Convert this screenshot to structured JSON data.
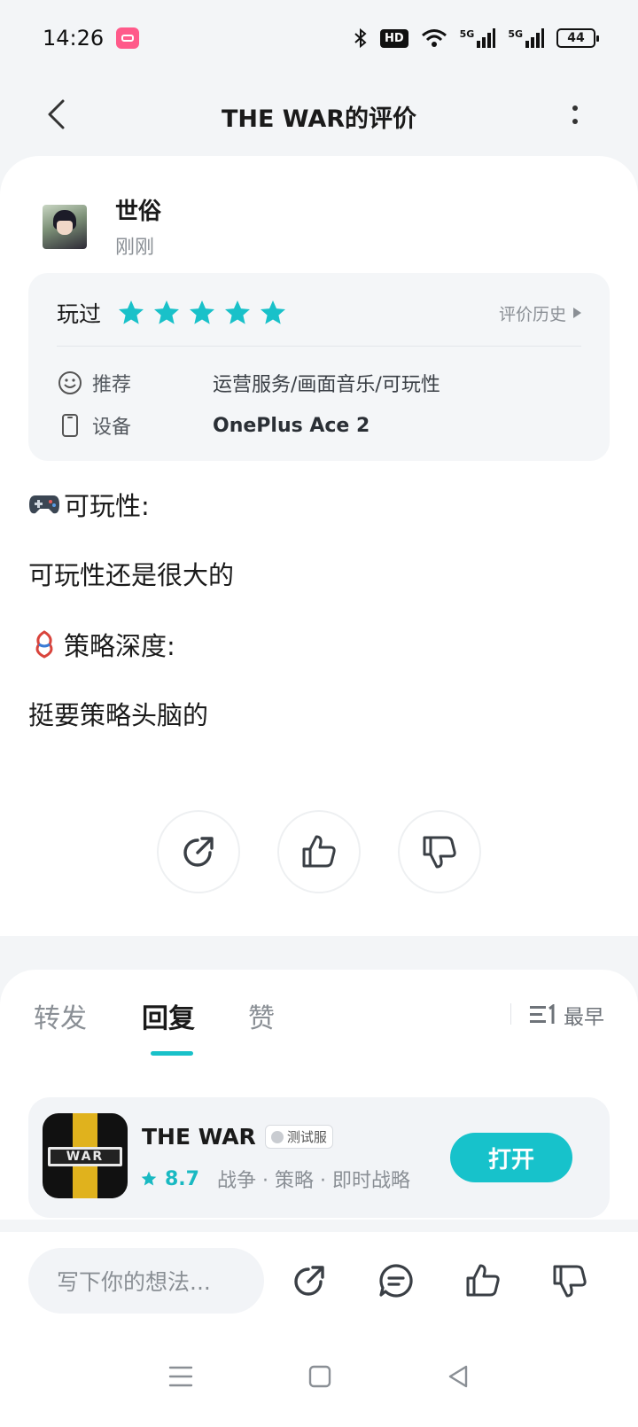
{
  "status_bar": {
    "time": "14:26",
    "battery": "44",
    "hd_label": "HD",
    "net1": "5G",
    "net2": "5G",
    "icons": [
      "app-badge-icon",
      "bluetooth-icon",
      "hd-icon",
      "wifi-icon",
      "signal-5g-icon",
      "signal-5g-icon",
      "battery-icon"
    ]
  },
  "nav": {
    "title": "THE WAR的评价"
  },
  "review": {
    "user_name": "世俗",
    "time": "刚刚",
    "played_label": "玩过",
    "stars": 5,
    "history_label": "评价历史",
    "recommend_label": "推荐",
    "recommend_value": "运营服务/画面音乐/可玩性",
    "device_label": "设备",
    "device_value": "OnePlus Ace 2",
    "section1_title": "可玩性:",
    "section1_text": "可玩性还是很大的",
    "section2_title": "策略深度:",
    "section2_text": "挺要策略头脑的"
  },
  "tabs": {
    "forward": "转发",
    "reply": "回复",
    "like": "赞",
    "sort": "最早"
  },
  "app": {
    "name": "THE WAR",
    "tag": "测试服",
    "score": "8.7",
    "genres": "战争 · 策略 · 即时战略",
    "open_label": "打开",
    "icon_text": "WAR"
  },
  "bottom": {
    "input_placeholder": "写下你的想法..."
  },
  "colors": {
    "accent": "#17c2cb",
    "star": "#19c1c9",
    "background": "#f3f5f7"
  }
}
